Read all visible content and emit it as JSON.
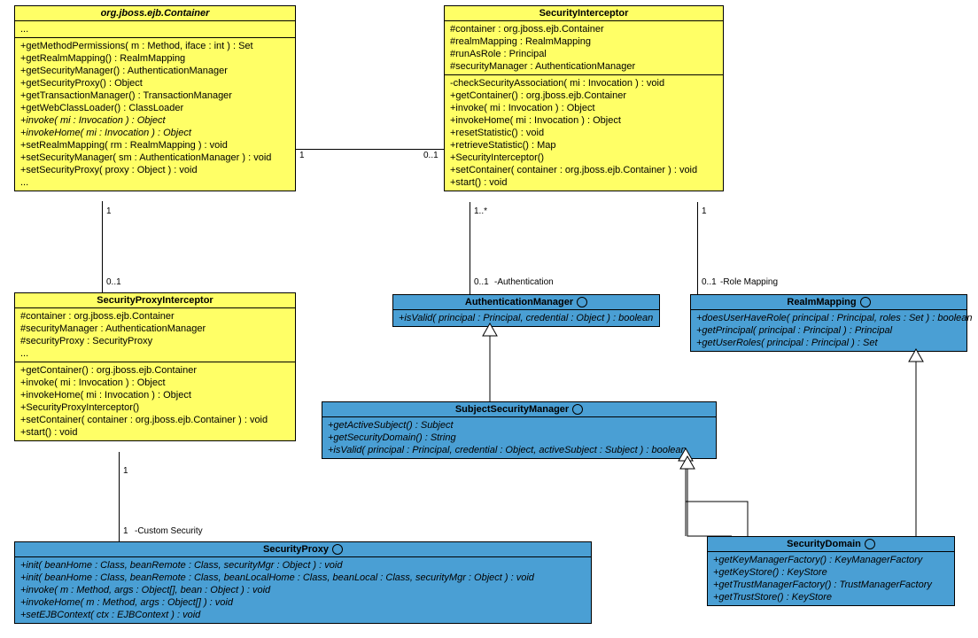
{
  "classes": {
    "container": {
      "title": "org.jboss.ejb.Container",
      "attrs": [
        "..."
      ],
      "ops": [
        "+getMethodPermissions( m : Method, iface : int ) : Set",
        "+getRealmMapping() : RealmMapping",
        "+getSecurityManager() : AuthenticationManager",
        "+getSecurityProxy() : Object",
        "+getTransactionManager() : TransactionManager",
        "+getWebClassLoader() : ClassLoader",
        "+invoke( mi : Invocation ) : Object",
        "+invokeHome( mi : Invocation ) : Object",
        "+setRealmMapping( rm : RealmMapping ) : void",
        "+setSecurityManager( sm : AuthenticationManager ) : void",
        "+setSecurityProxy( proxy : Object ) : void",
        "..."
      ]
    },
    "secint": {
      "title": "SecurityInterceptor",
      "attrs": [
        "#container : org.jboss.ejb.Container",
        "#realmMapping : RealmMapping",
        "#runAsRole : Principal",
        "#securityManager : AuthenticationManager"
      ],
      "ops": [
        "-checkSecurityAssociation( mi : Invocation ) : void",
        "+getContainer() : org.jboss.ejb.Container",
        "+invoke( mi : Invocation ) : Object",
        "+invokeHome( mi : Invocation ) : Object",
        "+resetStatistic() : void",
        "+retrieveStatistic() : Map",
        "+SecurityInterceptor()",
        "+setContainer( container : org.jboss.ejb.Container ) : void",
        "+start() : void"
      ]
    },
    "spi": {
      "title": "SecurityProxyInterceptor",
      "attrs": [
        "#container : org.jboss.ejb.Container",
        "#securityManager : AuthenticationManager",
        "#securityProxy : SecurityProxy",
        "..."
      ],
      "ops": [
        "+getContainer() : org.jboss.ejb.Container",
        "+invoke( mi : Invocation ) : Object",
        "+invokeHome( mi : Invocation ) : Object",
        "+SecurityProxyInterceptor()",
        "+setContainer( container : org.jboss.ejb.Container ) : void",
        "+start() : void"
      ]
    },
    "authmgr": {
      "title": "AuthenticationManager",
      "ops": [
        "+isValid( principal : Principal, credential : Object ) : boolean"
      ]
    },
    "realm": {
      "title": "RealmMapping",
      "ops": [
        "+doesUserHaveRole( principal : Principal, roles : Set ) : boolean",
        "+getPrincipal( principal : Principal ) : Principal",
        "+getUserRoles( principal : Principal ) : Set"
      ]
    },
    "subj": {
      "title": "SubjectSecurityManager",
      "ops": [
        "+getActiveSubject() : Subject",
        "+getSecurityDomain() : String",
        "+isValid( principal : Principal, credential : Object, activeSubject : Subject ) : boolean"
      ]
    },
    "secproxy": {
      "title": "SecurityProxy",
      "ops": [
        "+init( beanHome : Class, beanRemote : Class, securityMgr : Object ) : void",
        "+init( beanHome : Class, beanRemote : Class, beanLocalHome : Class, beanLocal : Class, securityMgr : Object ) : void",
        "+invoke( m : Method, args : Object[], bean : Object ) : void",
        "+invokeHome( m : Method, args : Object[] ) : void",
        "+setEJBContext( ctx : EJBContext ) : void"
      ]
    },
    "secdom": {
      "title": "SecurityDomain",
      "ops": [
        "+getKeyManagerFactory() : KeyManagerFactory",
        "+getKeyStore() : KeyStore",
        "+getTrustManagerFactory() : TrustManagerFactory",
        "+getTrustStore() : KeyStore"
      ]
    }
  },
  "labels": {
    "one": "1",
    "zone": "0..1",
    "onestar": "1..*",
    "auth": " -Authentication",
    "role": " -Role Mapping",
    "custom": " -Custom Security"
  }
}
